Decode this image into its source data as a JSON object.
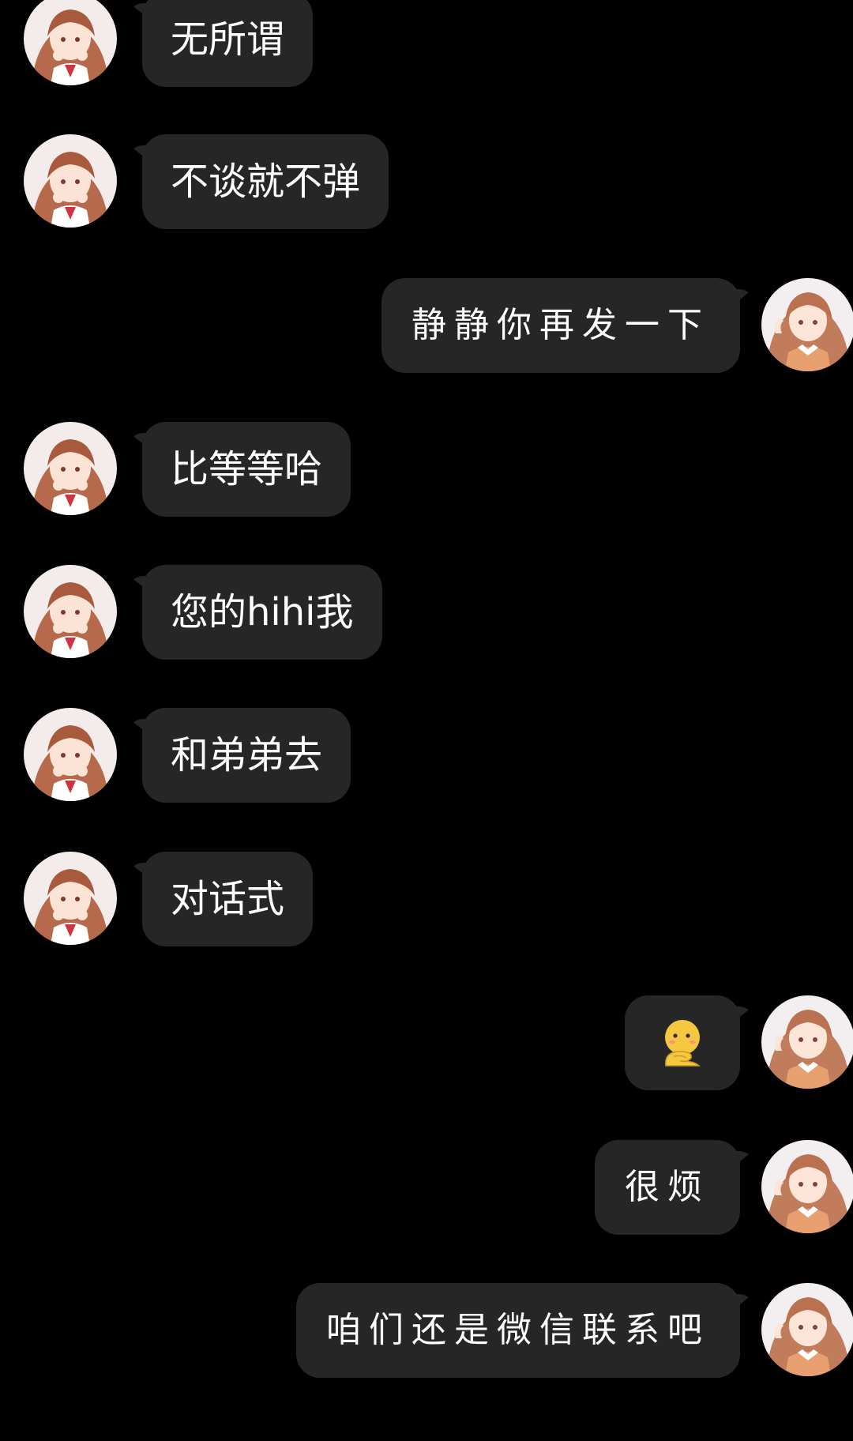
{
  "colors": {
    "background": "#000000",
    "bubble": "#262626",
    "text": "#ffffff",
    "emoji": "#f6c842"
  },
  "messages": [
    {
      "side": "left",
      "text": "无所谓"
    },
    {
      "side": "left",
      "text": "不谈就不弹"
    },
    {
      "side": "right",
      "text": "静静你再发一下"
    },
    {
      "side": "left",
      "text": "比等等哈"
    },
    {
      "side": "left",
      "text": "您的hihi我"
    },
    {
      "side": "left",
      "text": "和弟弟去"
    },
    {
      "side": "left",
      "text": "对话式"
    },
    {
      "side": "right",
      "emoji": "thinking-emoji"
    },
    {
      "side": "right",
      "text": "很烦"
    },
    {
      "side": "right",
      "text": "咱们还是微信联系吧"
    }
  ]
}
